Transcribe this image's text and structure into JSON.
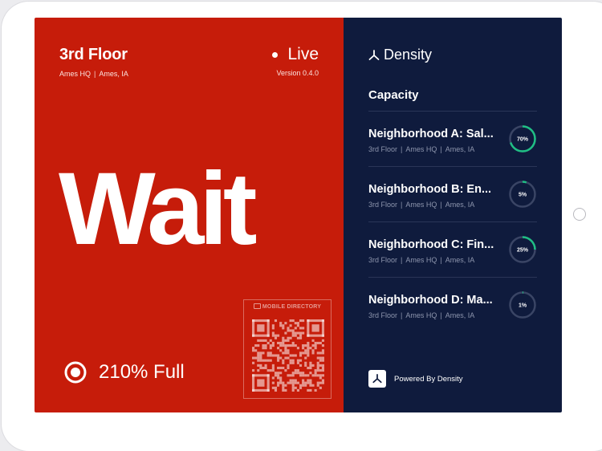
{
  "colors": {
    "status_bg": "#c61c0a",
    "panel_bg": "#0f1b3d",
    "ring_fill": "#1fbf84",
    "ring_track": "#3a4565"
  },
  "left": {
    "floor": "3rd Floor",
    "building": "Ames HQ",
    "separator": "|",
    "city": "Ames, IA",
    "live_label": "Live",
    "version": "Version 0.4.0",
    "status": "Wait",
    "qr_label": "MOBILE DIRECTORY",
    "qr_icon": "camera-icon",
    "occupancy": "210% Full",
    "occupancy_icon": "target-icon"
  },
  "right": {
    "brand": "Density",
    "brand_icon": "density-logo-icon",
    "capacity_title": "Capacity",
    "separator": "|",
    "neighborhoods": [
      {
        "name": "Neighborhood A: Sal...",
        "floor": "3rd Floor",
        "building": "Ames HQ",
        "city": "Ames, IA",
        "pct_label": "70%",
        "pct": 70
      },
      {
        "name": "Neighborhood B: En...",
        "floor": "3rd Floor",
        "building": "Ames HQ",
        "city": "Ames, IA",
        "pct_label": "5%",
        "pct": 5
      },
      {
        "name": "Neighborhood C: Fin...",
        "floor": "3rd Floor",
        "building": "Ames HQ",
        "city": "Ames, IA",
        "pct_label": "25%",
        "pct": 25
      },
      {
        "name": "Neighborhood D: Ma...",
        "floor": "3rd Floor",
        "building": "Ames HQ",
        "city": "Ames, IA",
        "pct_label": "1%",
        "pct": 1
      }
    ],
    "powered_by": "Powered By Density"
  }
}
